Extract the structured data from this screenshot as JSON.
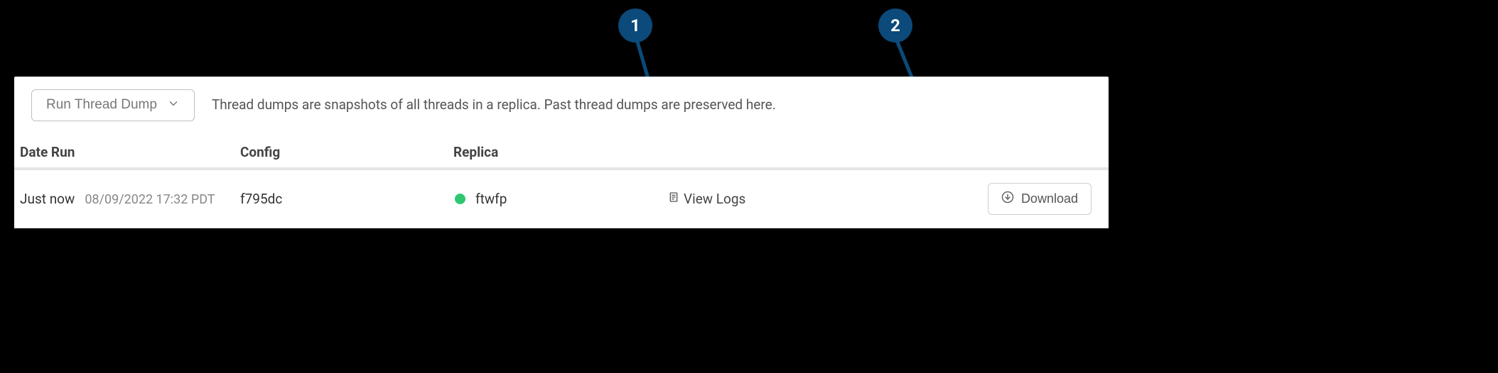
{
  "callouts": {
    "one": "1",
    "two": "2"
  },
  "header": {
    "run_dropdown_label": "Run Thread Dump",
    "description": "Thread dumps are snapshots of all threads in a replica. Past thread dumps are preserved here."
  },
  "table": {
    "columns": {
      "date": "Date Run",
      "config": "Config",
      "replica": "Replica"
    },
    "rows": [
      {
        "relative_time": "Just now",
        "absolute_time": "08/09/2022 17:32 PDT",
        "config": "f795dc",
        "replica_status_color": "#2ec770",
        "replica": "ftwfp",
        "view_logs_label": "View Logs",
        "download_label": "Download"
      }
    ]
  }
}
